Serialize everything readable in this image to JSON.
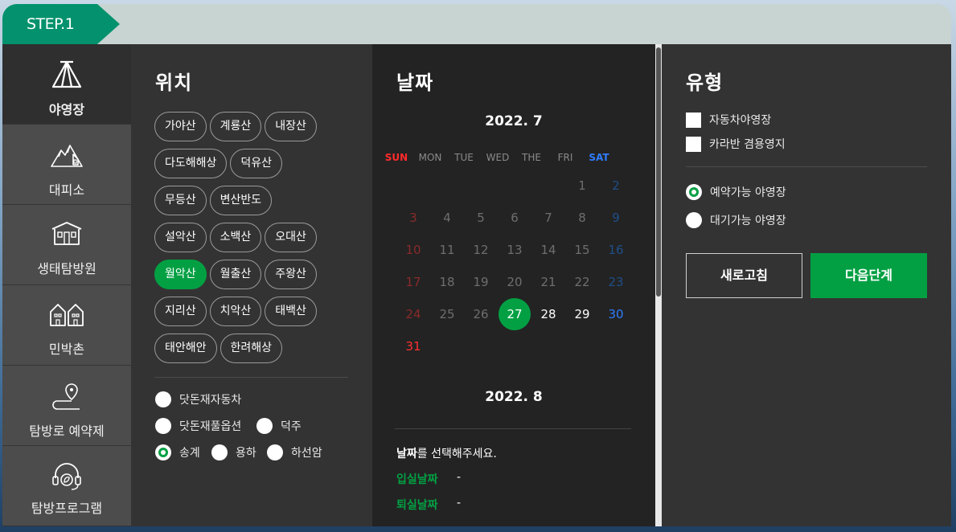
{
  "step": {
    "label": "STEP.1"
  },
  "sidebar": {
    "items": [
      {
        "label": "야영장",
        "icon": "tent-icon"
      },
      {
        "label": "대피소",
        "icon": "mountain-shelter-icon"
      },
      {
        "label": "생태탐방원",
        "icon": "building-icon"
      },
      {
        "label": "민박촌",
        "icon": "houses-icon"
      },
      {
        "label": "탐방로 예약제",
        "icon": "trail-pin-icon"
      },
      {
        "label": "탐방프로그램",
        "icon": "headset-leaf-icon"
      }
    ]
  },
  "location": {
    "title": "위치",
    "mountains": [
      "가야산",
      "계룡산",
      "내장산",
      "다도해해상",
      "덕유산",
      "무등산",
      "변산반도",
      "설악산",
      "소백산",
      "오대산",
      "월악산",
      "월출산",
      "주왕산",
      "지리산",
      "치악산",
      "태백산",
      "태안해안",
      "한려해상"
    ],
    "selected": "월악산",
    "options": [
      {
        "label": "닷돈재자동차",
        "selected": false
      },
      {
        "label": "닷돈재풀옵션",
        "selected": false
      },
      {
        "label": "덕주",
        "selected": false
      },
      {
        "label": "송계",
        "selected": true
      },
      {
        "label": "용하",
        "selected": false
      },
      {
        "label": "하선암",
        "selected": false
      }
    ]
  },
  "date": {
    "title": "날짜",
    "weekdays": [
      "SUN",
      "MON",
      "TUE",
      "WED",
      "THE",
      "FRI",
      "SAT"
    ],
    "month1": "2022. 7",
    "month2": "2022. 8",
    "july_days": [
      "",
      "",
      "",
      "",
      "",
      "1",
      "2",
      "3",
      "4",
      "5",
      "6",
      "7",
      "8",
      "9",
      "10",
      "11",
      "12",
      "13",
      "14",
      "15",
      "16",
      "17",
      "18",
      "19",
      "20",
      "21",
      "22",
      "23",
      "24",
      "25",
      "26",
      "27",
      "28",
      "29",
      "30",
      "31"
    ],
    "today": "27",
    "prompt_bold": "날짜",
    "prompt_rest": "를 선택해주세요.",
    "checkin_label": "입실날짜",
    "checkin_value": "-",
    "checkout_label": "퇴실날짜",
    "checkout_value": "-"
  },
  "type": {
    "title": "유형",
    "checkboxes": [
      "자동차야영장",
      "카라반 겸용영지"
    ],
    "radios": [
      {
        "label": "예약가능 야영장",
        "selected": true
      },
      {
        "label": "대기가능 야영장",
        "selected": false
      }
    ],
    "reset_label": "새로고침",
    "next_label": "다음단계"
  },
  "colors": {
    "accent": "#03a043",
    "step_tab": "#03926d",
    "sunday": "#ff3030",
    "saturday": "#2e7dff"
  }
}
